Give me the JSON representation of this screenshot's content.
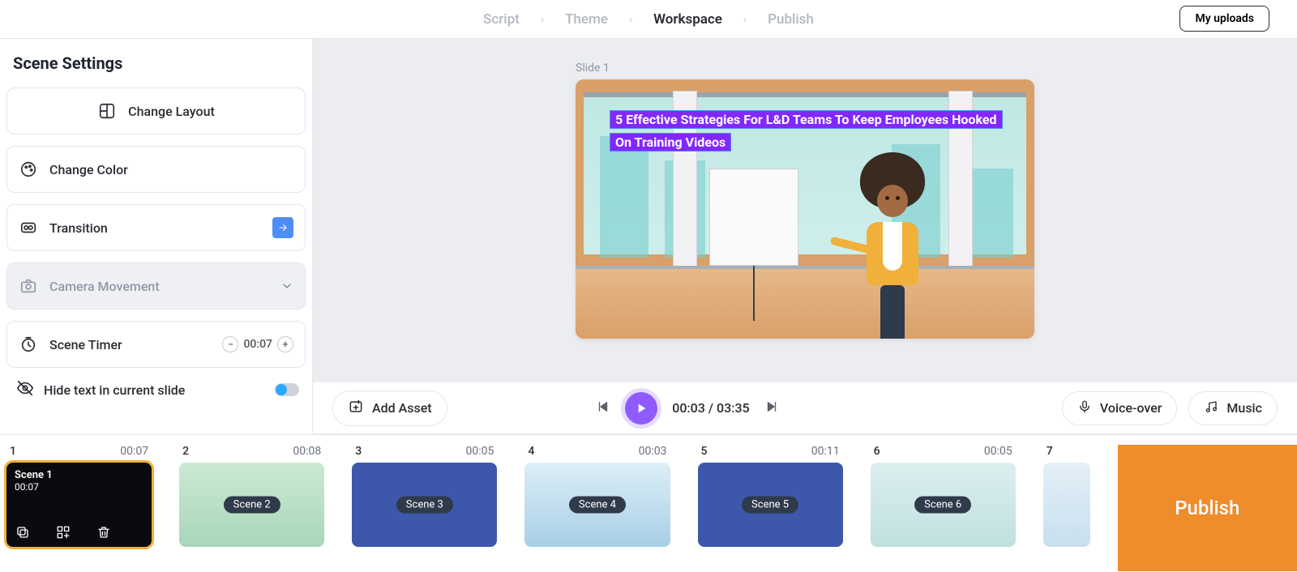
{
  "breadcrumb": {
    "steps": [
      "Script",
      "Theme",
      "Workspace",
      "Publish"
    ],
    "active_index": 2
  },
  "header": {
    "my_uploads": "My uploads"
  },
  "sidebar": {
    "title": "Scene Settings",
    "change_layout": "Change Layout",
    "change_color": "Change Color",
    "transition": "Transition",
    "camera_movement": "Camera Movement",
    "scene_timer": "Scene Timer",
    "scene_timer_value": "00:07",
    "hide_text": "Hide text in current slide"
  },
  "canvas": {
    "slide_label": "Slide 1",
    "headline": "5 Effective Strategies For L&D Teams To Keep Employees Hooked On Training Videos"
  },
  "playbar": {
    "add_asset": "Add Asset",
    "current_time": "00:03",
    "total_time": "03:35",
    "voice_over": "Voice-over",
    "music": "Music"
  },
  "timeline": {
    "publish": "Publish",
    "scenes": [
      {
        "n": "1",
        "dur": "00:07",
        "chip": "Scene 1",
        "sub": "00:07",
        "active": true
      },
      {
        "n": "2",
        "dur": "00:08",
        "chip": "Scene 2"
      },
      {
        "n": "3",
        "dur": "00:05",
        "chip": "Scene 3"
      },
      {
        "n": "4",
        "dur": "00:03",
        "chip": "Scene 4"
      },
      {
        "n": "5",
        "dur": "00:11",
        "chip": "Scene 5"
      },
      {
        "n": "6",
        "dur": "00:05",
        "chip": "Scene 6"
      },
      {
        "n": "7",
        "dur": "",
        "chip": ""
      }
    ]
  }
}
